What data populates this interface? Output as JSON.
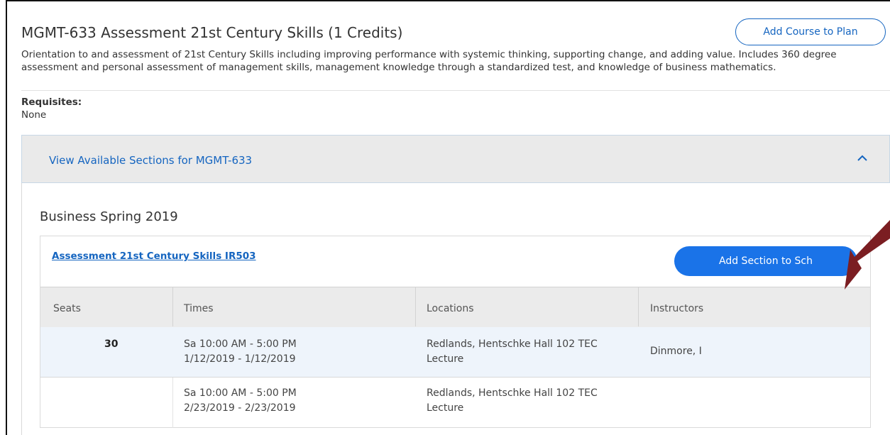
{
  "course": {
    "title": "MGMT-633 Assessment 21st Century Skills (1 Credits)",
    "add_to_plan_label": "Add Course to Plan",
    "description": "Orientation to and assessment of 21st Century Skills including improving performance with systemic thinking, supporting change, and adding value. Includes 360 degree assessment and personal assessment of management skills, management knowledge through a standardized test, and knowledge of business mathematics.",
    "requisites_label": "Requisites:",
    "requisites_value": "None"
  },
  "sections_panel": {
    "header_label": "View Available Sections for MGMT-633",
    "expanded": true,
    "toggle_icon": "chevron-up-icon"
  },
  "term": {
    "title": "Business Spring 2019"
  },
  "section": {
    "link_label": "Assessment 21st Century Skills IR503",
    "add_button_label": "Add Section to Sch",
    "columns": [
      "Seats",
      "Times",
      "Locations",
      "Instructors"
    ],
    "rows": [
      {
        "seats": "30",
        "time_line1": "Sa 10:00 AM - 5:00 PM",
        "time_line2": "1/12/2019 - 1/12/2019",
        "location_line1": "Redlands, Hentschke Hall 102 TEC",
        "location_line2": "Lecture",
        "instructor": "Dinmore, I"
      },
      {
        "seats": "",
        "time_line1": "Sa 10:00 AM - 5:00 PM",
        "time_line2": "2/23/2019 - 2/23/2019",
        "location_line1": "Redlands, Hentschke Hall 102 TEC",
        "location_line2": "Lecture",
        "instructor": ""
      }
    ]
  },
  "annotation": {
    "arrow_color": "#7b1e22"
  },
  "colors": {
    "link_blue": "#1565c0",
    "button_blue": "#1a73e8",
    "header_gray": "#eaeaea",
    "row_highlight": "#eef4fb"
  }
}
